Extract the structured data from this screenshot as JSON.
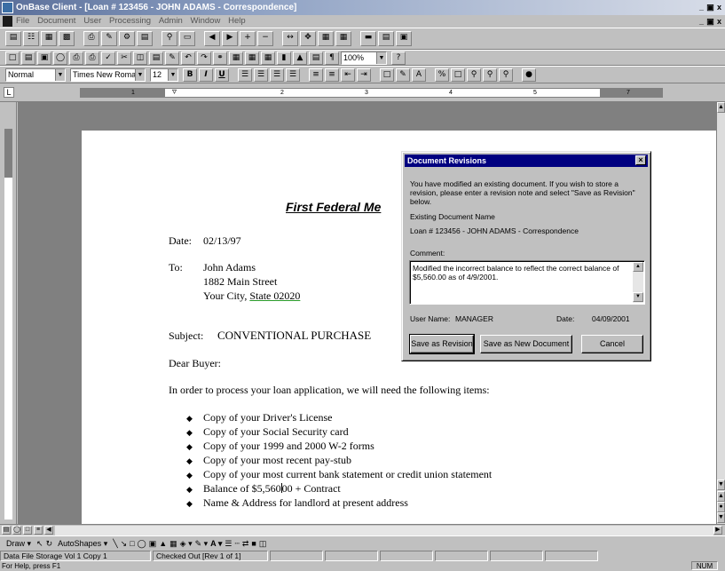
{
  "window": {
    "title": "OnBase Client - [Loan # 123456 - JOHN ADAMS - Correspondence]"
  },
  "menu": [
    "File",
    "Document",
    "User",
    "Processing",
    "Admin",
    "Window",
    "Help"
  ],
  "formatting": {
    "style": "Normal",
    "font": "Times New Roman",
    "size": "12",
    "zoom": "100%"
  },
  "ruler_numbers": [
    "1",
    "2",
    "3",
    "4",
    "5",
    "7"
  ],
  "document": {
    "heading": "First Federal Me",
    "date_label": "Date:",
    "date_value": "02/13/97",
    "to_label": "To:",
    "to_name": "John Adams",
    "to_street": "1882 Main Street",
    "to_city": "Your City, ",
    "to_state_zip": "State  02020",
    "subject_label": "Subject:",
    "subject_value": "CONVENTIONAL PURCHASE",
    "salutation": "Dear Buyer:",
    "intro": "In order to process your loan application, we will need the following items:",
    "items": [
      "Copy of your Driver's License",
      "Copy of your Social Security card",
      "Copy of your 1999 and 2000 W-2 forms",
      "Copy of your most recent pay-stub",
      "Copy of your most current bank statement or credit union statement",
      "Balance of $5,560",
      "Name & Address for landlord at present address"
    ],
    "item_balance_tail": "00 + Contract"
  },
  "dialog": {
    "title": "Document Revisions",
    "message_lines": [
      "You have modified an existing document. If you wish to store a",
      "revision, please enter a revision note and select \"Save as Revision\"",
      "below."
    ],
    "existing_label": "Existing Document Name",
    "existing_value": "Loan # 123456 - JOHN ADAMS - Correspondence",
    "comment_label": "Comment:",
    "comment_value": "Modified the incorrect balance to reflect the correct balance of $5,560.00 as of 4/9/2001.",
    "user_label": "User Name:",
    "user_value": "MANAGER",
    "date_label": "Date:",
    "date_value": "04/09/2001",
    "buttons": {
      "save_revision": "Save as Revision",
      "save_new": "Save as New Document",
      "cancel": "Cancel"
    }
  },
  "drawbar": {
    "draw": "Draw",
    "autoshapes": "AutoShapes"
  },
  "status": {
    "storage": "Data File Storage Vol 1 Copy 1",
    "checkout": "Checked Out [Rev 1 of 1]",
    "help": "For Help, press F1",
    "mode": "NUM"
  }
}
